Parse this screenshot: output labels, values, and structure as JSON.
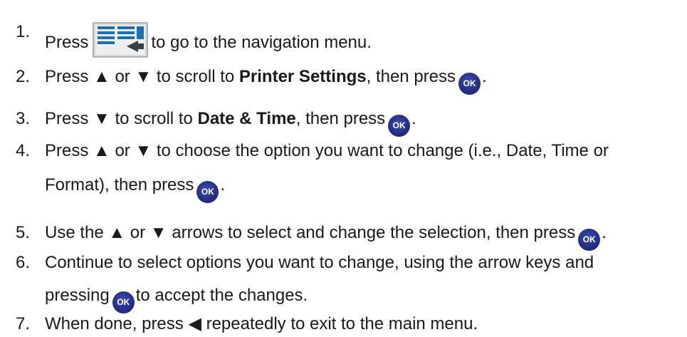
{
  "steps": [
    {
      "num": "1.",
      "a": "Press",
      "b": "to go to the navigation menu."
    },
    {
      "num": "2.",
      "a": "Press ▲ or ▼ to scroll to ",
      "bold": "Printer Settings",
      "b": ", then press",
      "c": "."
    },
    {
      "num": "3.",
      "a": "Press ▼ to scroll to ",
      "bold": "Date & Time",
      "b": ", then press",
      "c": "."
    },
    {
      "num": "4.",
      "a": "Press ▲ or ▼ to choose the option you want to change (i.e., Date, Time or",
      "cont_a": "Format), then press",
      "cont_b": "."
    },
    {
      "num": "5.",
      "a": "Use the ▲ or ▼ arrows to select and change the selection, then press",
      "b": "."
    },
    {
      "num": "6.",
      "a": "Continue to select options you want to change, using the arrow keys and",
      "cont_a": "pressing",
      "cont_b": "to accept the changes."
    },
    {
      "num": "7.",
      "a": "When done, press ◀ repeatedly to exit to the main menu."
    }
  ],
  "icons": {
    "ok_button": "ok-button-icon",
    "menu_button": "navigation-menu-button-icon"
  },
  "colors": {
    "ok_blue": "#262f86",
    "menu_icon_blue": "#1f6fb0",
    "text": "#1a1a1a"
  }
}
